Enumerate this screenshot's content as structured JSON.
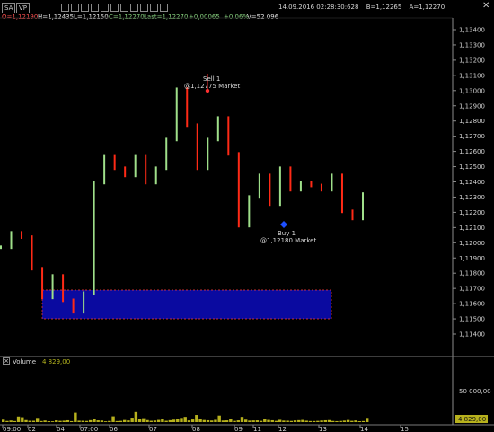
{
  "header": {
    "symbol_tag": "SA",
    "profile_tag": "VP",
    "ohlc": {
      "open": "O=1,12190",
      "high": "H=1,12435",
      "low": "L=1,12150",
      "close": "C=1,12270",
      "last": "Last=1,12270",
      "change_abs": "+0,00065",
      "change_pct": "+0,06%",
      "volume": "V=52 096"
    },
    "datetime": "14.09.2016  02:28:30:628",
    "bid": "B=1,12265",
    "ask": "A=1,12270"
  },
  "price_axis": {
    "labels": [
      "1,13400",
      "1,13300",
      "1,13200",
      "1,13100",
      "1,13000",
      "1,12900",
      "1,12800",
      "1,12700",
      "1,12600",
      "1,12500",
      "1,12400",
      "1,12300",
      "1,12200",
      "1,12100",
      "1,12000",
      "1,11900",
      "1,11800",
      "1,11700",
      "1,11600",
      "1,11500",
      "1,11400"
    ],
    "ylim": [
      1.11345,
      1.13465
    ]
  },
  "time_axis": {
    "labels": [
      "09:00",
      "02",
      "04",
      "07:00",
      "06",
      "07",
      "08",
      "09",
      "11",
      "12",
      "13",
      "14",
      "15"
    ]
  },
  "annotations": {
    "sell_label": "Sell 1",
    "sell_detail": "@1,12775 Market",
    "buy_label": "Buy 1",
    "buy_detail": "@1,12180 Market"
  },
  "volume_panel": {
    "title": "Volume",
    "value": "4 829,00",
    "axis_label": "50 000,00",
    "last_badge": "4 829,00"
  },
  "colors": {
    "up_candle": "#9fdf8a",
    "down_candle": "#ff2a16",
    "zone_fill": "#0a0aa0",
    "zone_border": "#ff3b3b",
    "volume": "#b7b11d",
    "buy_marker": "#1d4fff",
    "sell_marker": "#ff3030"
  },
  "chart_data": [
    {
      "type": "line",
      "x_index": [
        0,
        2,
        4,
        6,
        8,
        10,
        12,
        14,
        16,
        18,
        20,
        22,
        24,
        26,
        28,
        30,
        32,
        34,
        36,
        38,
        40,
        42,
        44,
        46,
        48,
        50,
        52,
        54,
        56,
        58,
        60,
        62,
        64,
        66,
        68,
        70,
        72,
        74,
        76,
        78,
        80,
        82,
        84,
        86,
        88,
        90,
        92,
        94,
        96,
        98,
        100
      ],
      "series": [
        {
          "values": [
            1.1195,
            1.1205,
            1.1202,
            1.118,
            1.116,
            1.1175,
            1.1158,
            1.115,
            1.1163,
            1.124,
            1.1258,
            1.125,
            1.1245,
            1.1258,
            1.124,
            1.125,
            1.127,
            1.1305,
            1.128,
            1.125,
            1.127,
            1.1285,
            1.126,
            1.121,
            1.123,
            1.1245,
            1.1225,
            1.125,
            1.1235,
            1.124,
            1.1238,
            1.1235,
            1.1245,
            1.122,
            1.1215,
            1.1232
          ]
        }
      ]
    },
    {
      "type": "bar",
      "categories_count": 96,
      "values": [
        2800,
        1300,
        1800,
        1200,
        6400,
        5600,
        2300,
        1500,
        1500,
        4800,
        1200,
        1800,
        1000,
        900,
        2000,
        1400,
        1600,
        2100,
        1100,
        10700,
        1600,
        1500,
        1300,
        2200,
        3900,
        2000,
        1800,
        900,
        1300,
        6600,
        1200,
        1400,
        2400,
        1900,
        5100,
        11500,
        3600,
        4500,
        2300,
        1500,
        1800,
        2500,
        3100,
        1500,
        2200,
        2800,
        3500,
        4800,
        6000,
        1900,
        3000,
        8200,
        3600,
        2400,
        2100,
        1800,
        2600,
        7500,
        1800,
        2000,
        3900,
        1400,
        2000,
        6000,
        2800,
        1700,
        1900,
        2000,
        1400,
        3400,
        2500,
        2100,
        1400,
        2600,
        1700,
        1600,
        1300,
        1900,
        2200,
        2500,
        1600,
        1200,
        1200,
        1400,
        1800,
        2100,
        2300,
        1300,
        1100,
        1300,
        1700,
        2400,
        1400,
        1900,
        1000,
        1200,
        4829
      ],
      "ylabel": "",
      "ylim": [
        0,
        70000
      ]
    }
  ]
}
